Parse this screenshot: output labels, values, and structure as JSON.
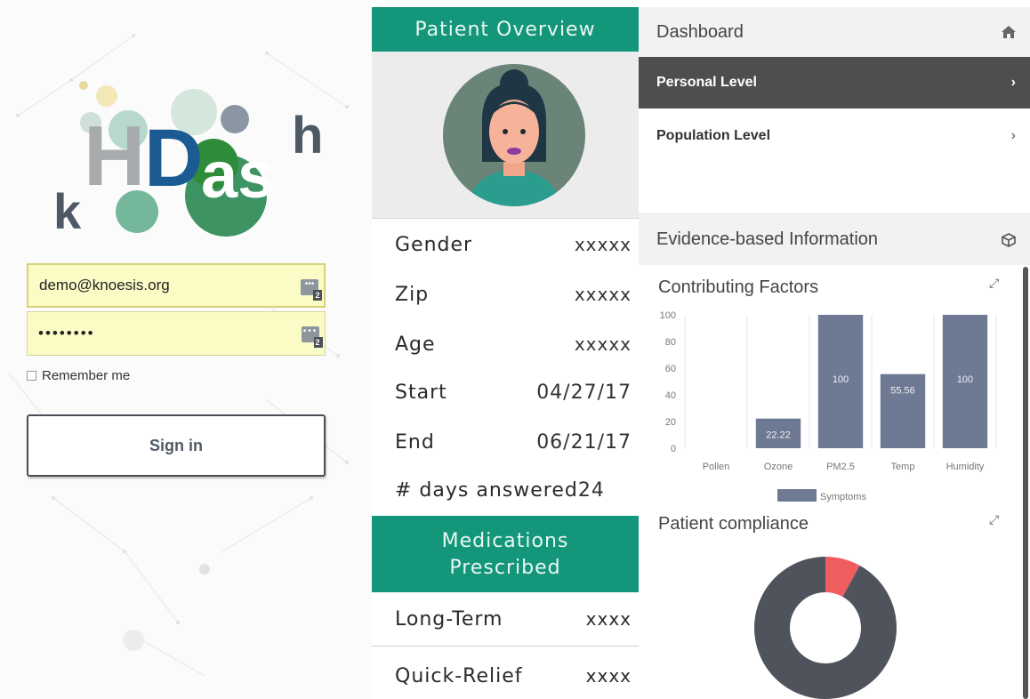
{
  "login": {
    "logo": {
      "k": "k",
      "H": "H",
      "D": "D",
      "as": "as",
      "h": "h"
    },
    "email_value": "demo@knoesis.org",
    "password_value": "••••••••",
    "pm_badge": "2",
    "remember_label": "Remember me",
    "signin_label": "Sign in"
  },
  "overview": {
    "title": "Patient Overview",
    "fields": [
      {
        "label": "Gender",
        "value": "xxxxx"
      },
      {
        "label": "Zip",
        "value": "xxxxx"
      },
      {
        "label": "Age",
        "value": "xxxxx"
      },
      {
        "label": "Start",
        "value": "04/27/17"
      },
      {
        "label": "End",
        "value": "06/21/17"
      },
      {
        "label": "# days answered",
        "value": "24"
      }
    ],
    "medications_title_line1": "Medications",
    "medications_title_line2": "Prescribed",
    "medications": [
      {
        "label": "Long-Term",
        "value": "xxxx"
      },
      {
        "label": "Quick-Relief",
        "value": "xxxx"
      }
    ]
  },
  "dashboard": {
    "title": "Dashboard",
    "nav": {
      "personal": "Personal Level",
      "population": "Population Level"
    },
    "evidence_title": "Evidence-based Information",
    "contributing_title": "Contributing Factors",
    "compliance_title": "Patient compliance"
  },
  "colors": {
    "teal": "#14967a",
    "bar": "#6e7a93",
    "donut_main": "#4f535c",
    "donut_slice": "#ef5d5f"
  },
  "chart_data": [
    {
      "type": "bar",
      "title": "Contributing Factors",
      "categories": [
        "Pollen",
        "Ozone",
        "PM2.5",
        "Temp",
        "Humidity"
      ],
      "series": [
        {
          "name": "Symptoms",
          "values": [
            0,
            22.22,
            100,
            55.56,
            100
          ]
        }
      ],
      "data_labels": [
        "",
        "22.22",
        "100",
        "55.56",
        "100"
      ],
      "yticks": [
        0,
        20,
        40,
        60,
        80,
        100
      ],
      "ylim": [
        0,
        100
      ],
      "grid": "vertical",
      "legend": "bottom"
    },
    {
      "type": "pie",
      "title": "Patient compliance",
      "donut": true,
      "slices": [
        {
          "value": 92
        },
        {
          "value": 8
        }
      ]
    }
  ]
}
